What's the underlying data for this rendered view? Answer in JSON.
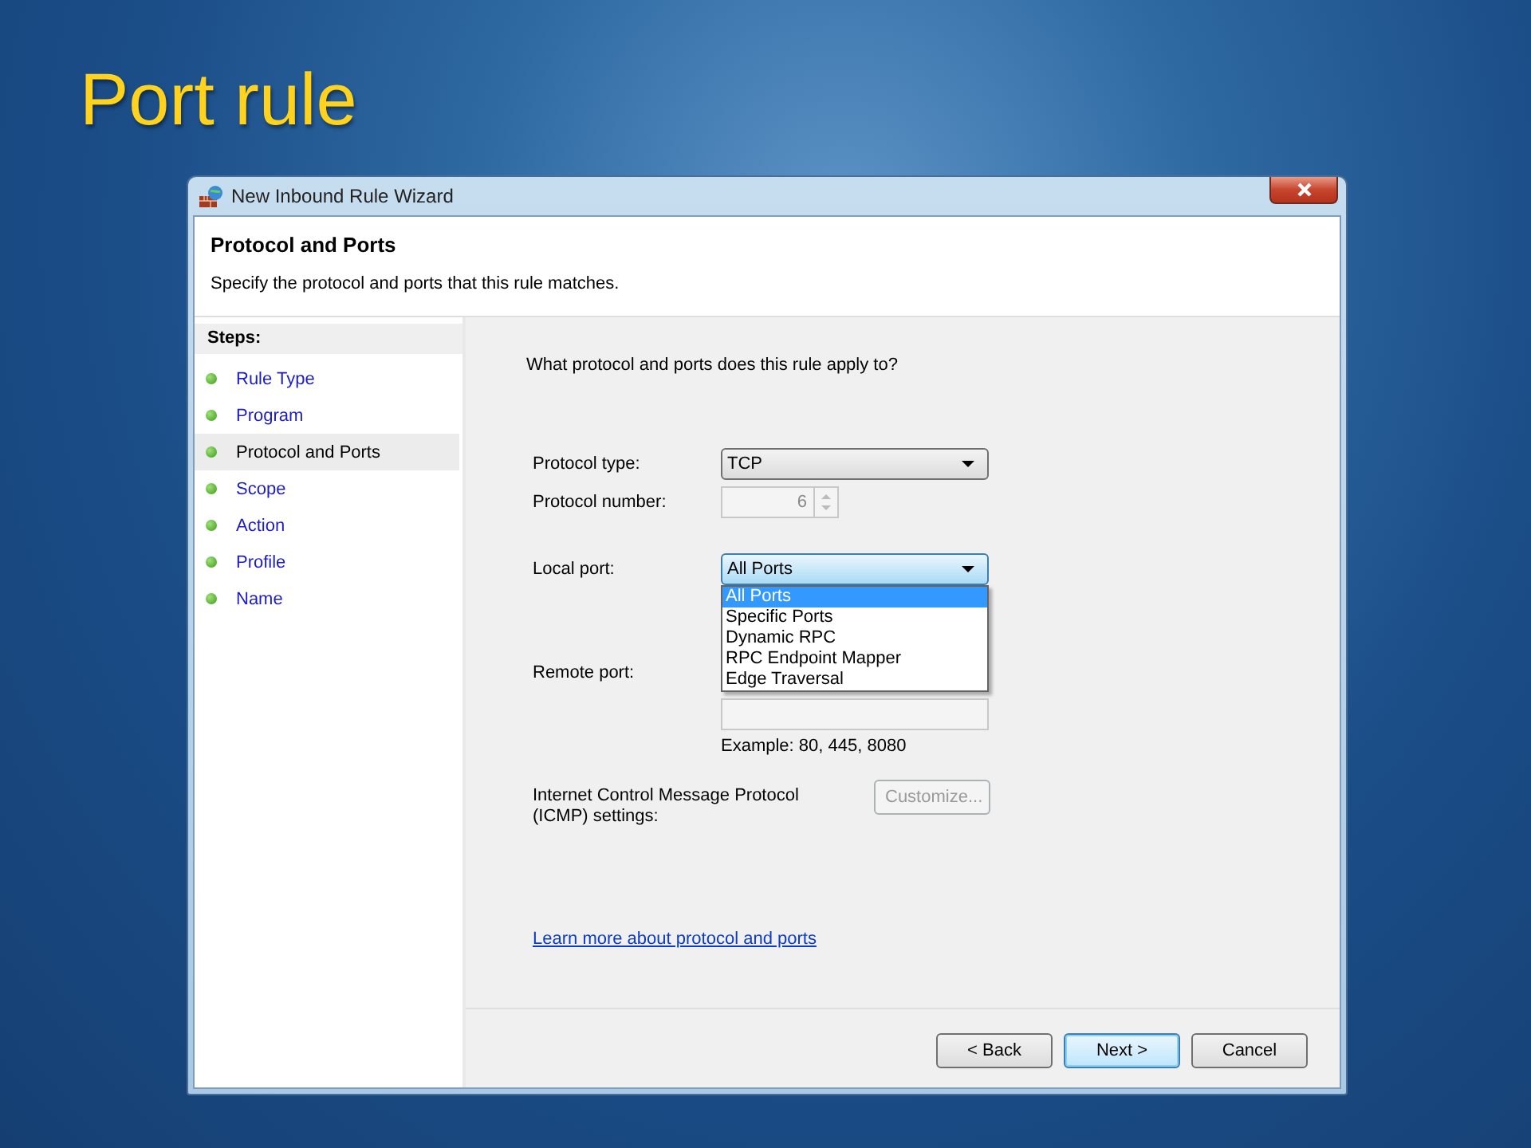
{
  "slide": {
    "title": "Port rule"
  },
  "window": {
    "title": "New Inbound Rule Wizard"
  },
  "header": {
    "heading": "Protocol and Ports",
    "description": "Specify the protocol and ports that this rule matches."
  },
  "steps": {
    "heading": "Steps:",
    "items": [
      {
        "label": "Rule Type",
        "selected": false
      },
      {
        "label": "Program",
        "selected": false
      },
      {
        "label": "Protocol and Ports",
        "selected": true
      },
      {
        "label": "Scope",
        "selected": false
      },
      {
        "label": "Action",
        "selected": false
      },
      {
        "label": "Profile",
        "selected": false
      },
      {
        "label": "Name",
        "selected": false
      }
    ]
  },
  "question": "What protocol and ports does this rule apply to?",
  "protocol_type": {
    "label": "Protocol type:",
    "value": "TCP"
  },
  "protocol_number": {
    "label": "Protocol number:",
    "value": "6",
    "disabled": true
  },
  "local_port": {
    "label": "Local port:",
    "value": "All Ports",
    "expanded": true,
    "options": [
      {
        "label": "All Ports",
        "selected": true
      },
      {
        "label": "Specific Ports",
        "selected": false
      },
      {
        "label": "Dynamic RPC",
        "selected": false
      },
      {
        "label": "RPC Endpoint Mapper",
        "selected": false
      },
      {
        "label": "Edge Traversal",
        "selected": false
      }
    ]
  },
  "remote_port": {
    "label": "Remote port:",
    "example": "Example: 80, 445, 8080"
  },
  "icmp": {
    "label": "Internet Control Message Protocol (ICMP) settings:",
    "button": {
      "label": "Customize...",
      "disabled": true
    }
  },
  "link": "Learn more about protocol and ports",
  "buttons": [
    {
      "label": "< Back",
      "default": false
    },
    {
      "label": "Next >",
      "default": true
    },
    {
      "label": "Cancel",
      "default": false
    }
  ]
}
